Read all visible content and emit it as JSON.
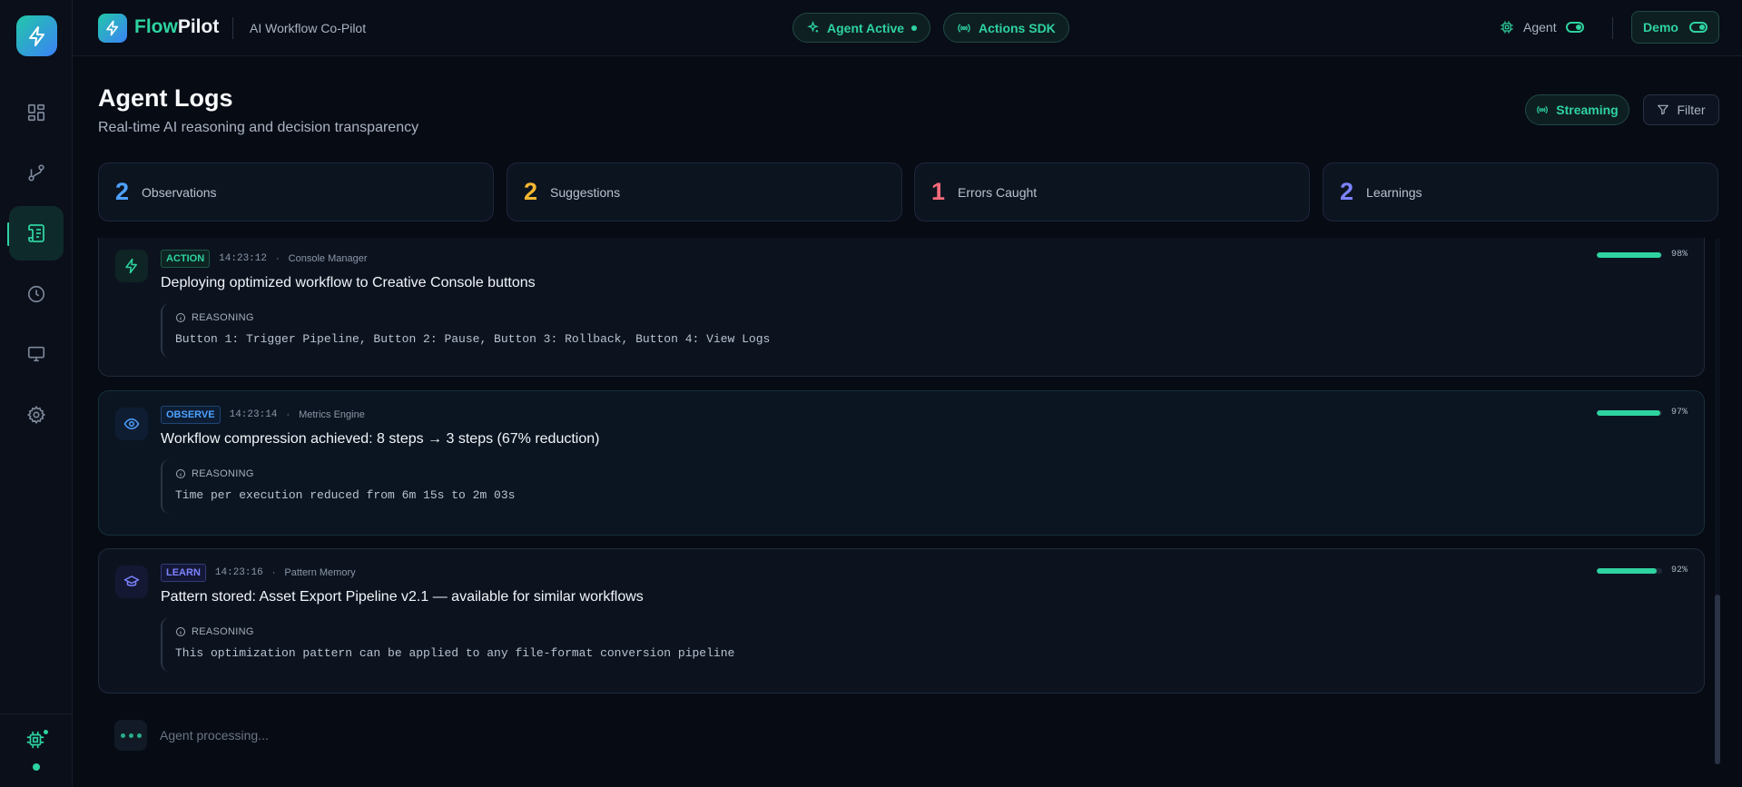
{
  "app": {
    "brand_part1": "Flow",
    "brand_part2": "Pilot",
    "subtitle": "AI Workflow Co-Pilot"
  },
  "header": {
    "agent_status": "Agent Active",
    "sdk_label": "Actions SDK",
    "agent_toggle_label": "Agent",
    "demo_label": "Demo"
  },
  "page": {
    "title": "Agent Logs",
    "subtitle": "Real-time AI reasoning and decision transparency",
    "streaming_label": "Streaming",
    "filter_label": "Filter"
  },
  "stats": [
    {
      "count": "2",
      "label": "Observations",
      "color": "#4ea1ff"
    },
    {
      "count": "2",
      "label": "Suggestions",
      "color": "#f5b731"
    },
    {
      "count": "1",
      "label": "Errors Caught",
      "color": "#f56b7a"
    },
    {
      "count": "2",
      "label": "Learnings",
      "color": "#7c83ff"
    }
  ],
  "logs": [
    {
      "type": "ACTION",
      "icon": "lightning-icon",
      "time": "14:23:12",
      "separator": "·",
      "source": "Console Manager",
      "title": "Deploying optimized workflow to Creative Console buttons",
      "reasoning_label": "REASONING",
      "reasoning": "Button 1: Trigger Pipeline, Button 2: Pause, Button 3: Rollback, Button 4: View Logs",
      "confidence": 98,
      "confidence_label": "98%"
    },
    {
      "type": "OBSERVE",
      "icon": "eye-icon",
      "time": "14:23:14",
      "separator": "·",
      "source": "Metrics Engine",
      "title": "Workflow compression achieved: 8 steps → 3 steps (67% reduction)",
      "reasoning_label": "REASONING",
      "reasoning": "Time per execution reduced from 6m 15s to 2m 03s",
      "confidence": 97,
      "confidence_label": "97%"
    },
    {
      "type": "LEARN",
      "icon": "graduation-cap-icon",
      "time": "14:23:16",
      "separator": "·",
      "source": "Pattern Memory",
      "title": "Pattern stored: Asset Export Pipeline v2.1 — available for similar workflows",
      "reasoning_label": "REASONING",
      "reasoning": "This optimization pattern can be applied to any file-format conversion pipeline",
      "confidence": 92,
      "confidence_label": "92%"
    }
  ],
  "processing": {
    "label": "Agent processing..."
  },
  "sidebar": {
    "items": [
      {
        "icon": "dashboard-grid-icon",
        "active": false
      },
      {
        "icon": "git-branch-icon",
        "active": false
      },
      {
        "icon": "scroll-logs-icon",
        "active": true
      },
      {
        "icon": "clock-icon",
        "active": false
      },
      {
        "icon": "monitor-icon",
        "active": false
      },
      {
        "icon": "gear-icon",
        "active": false
      }
    ]
  },
  "colors": {
    "accent": "#2ed3a0",
    "background": "#070b14"
  }
}
